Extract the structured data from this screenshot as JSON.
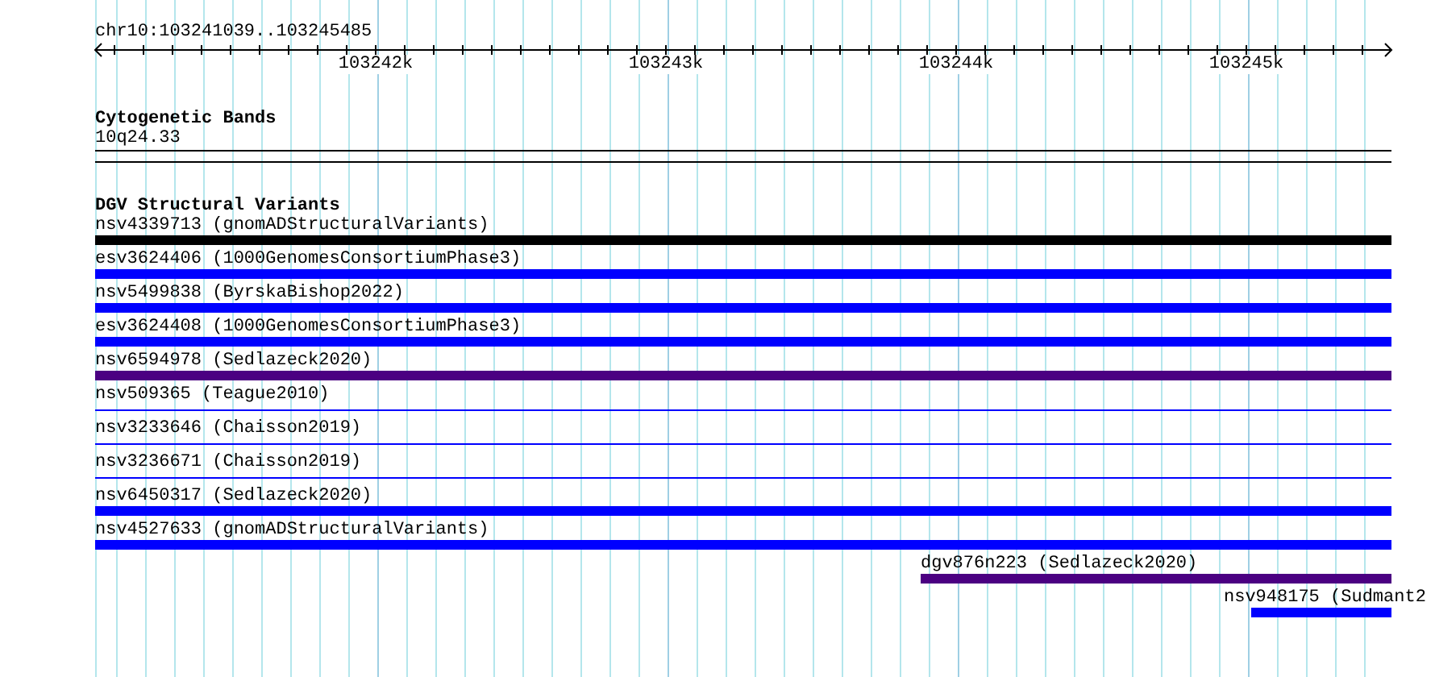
{
  "location": "chr10:103241039..103245485",
  "ruler": {
    "labels": [
      "103242k",
      "103243k",
      "103244k",
      "103245k"
    ]
  },
  "bands_track": {
    "title": "Cytogenetic Bands",
    "features": [
      {
        "label": "10q24.33"
      }
    ]
  },
  "variants_track": {
    "title": "DGV Structural Variants",
    "features": [
      {
        "label": "nsv4339713 (gnomADStructuralVariants)",
        "color": "#000000",
        "kind": "thick"
      },
      {
        "label": "esv3624406 (1000GenomesConsortiumPhase3)",
        "color": "#0000ff",
        "kind": "thick"
      },
      {
        "label": "nsv5499838 (ByrskaBishop2022)",
        "color": "#0000ff",
        "kind": "thick"
      },
      {
        "label": "esv3624408 (1000GenomesConsortiumPhase3)",
        "color": "#0000ff",
        "kind": "thick"
      },
      {
        "label": "nsv6594978 (Sedlazeck2020)",
        "color": "#4b0082",
        "kind": "thick"
      },
      {
        "label": "nsv509365 (Teague2010)",
        "color": "#0000ff",
        "kind": "thin"
      },
      {
        "label": "nsv3233646 (Chaisson2019)",
        "color": "#0000ff",
        "kind": "thin"
      },
      {
        "label": "nsv3236671 (Chaisson2019)",
        "color": "#0000ff",
        "kind": "thin"
      },
      {
        "label": "nsv6450317 (Sedlazeck2020)",
        "color": "#0000ff",
        "kind": "thick"
      },
      {
        "label": "nsv4527633 (gnomADStructuralVariants)",
        "color": "#0000ff",
        "kind": "thick"
      },
      {
        "label": "dgv876n223 (Sedlazeck2020)",
        "color": "#4b0082",
        "kind": "thick"
      },
      {
        "label": "nsv948175 (Sudmant2",
        "color": "#0000ff",
        "kind": "thick"
      }
    ]
  }
}
